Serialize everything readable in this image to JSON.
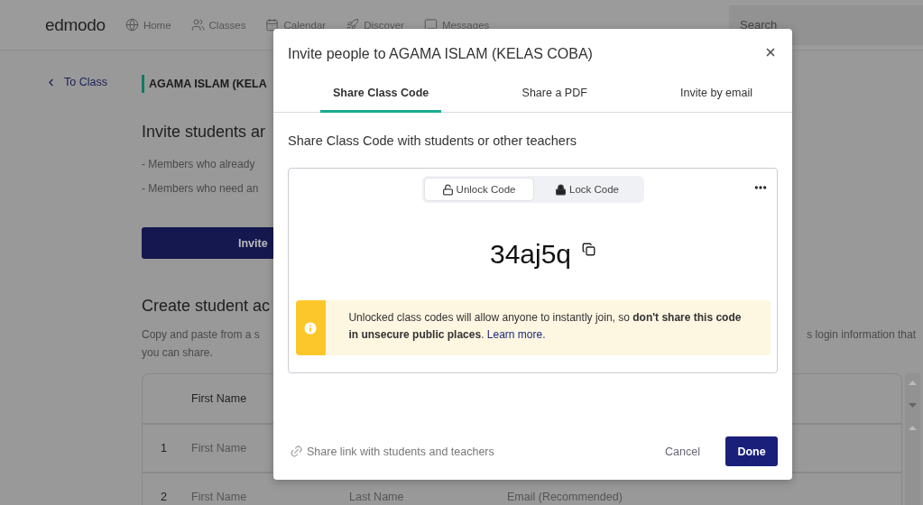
{
  "nav": {
    "logo": "edmodo",
    "items": [
      {
        "label": "Home"
      },
      {
        "label": "Classes"
      },
      {
        "label": "Calendar"
      },
      {
        "label": "Discover"
      },
      {
        "label": "Messages"
      }
    ],
    "search": {
      "placeholder": "Search"
    }
  },
  "back_link": "To Class",
  "class_title": "AGAMA ISLAM (KELA",
  "invite_section": {
    "heading": "Invite students ar",
    "notes": [
      "- Members who already",
      "- Members who need an"
    ],
    "button": "Invite"
  },
  "create_section": {
    "heading": "Create student ac",
    "text_lines": [
      "Copy and paste from a s",
      "you can share."
    ],
    "text_right": "s login information that"
  },
  "table": {
    "header": [
      "First Name"
    ],
    "rows": [
      {
        "number": "1",
        "cells": [
          "First Name"
        ]
      },
      {
        "number": "2",
        "cells": [
          "First Name",
          "Last Name",
          "Email (Recommended)"
        ]
      }
    ]
  },
  "modal": {
    "title": "Invite people to AGAMA ISLAM (KELAS COBA)",
    "tabs": [
      {
        "label": "Share Class Code",
        "selected": true
      },
      {
        "label": "Share a PDF",
        "selected": false
      },
      {
        "label": "Invite by email",
        "selected": false
      }
    ],
    "subtitle": "Share Class Code with students or other teachers",
    "toggle": [
      {
        "label": "Unlock Code",
        "selected": true
      },
      {
        "label": "Lock Code",
        "selected": false
      }
    ],
    "code": "34aj5q",
    "warning": {
      "text": "Unlocked class codes will allow anyone to instantly join, so **don't share this code in unsecure public places**.",
      "link": "Learn more."
    },
    "share_link": "Share link with students and teachers",
    "cancel": "Cancel",
    "done": "Done"
  }
}
